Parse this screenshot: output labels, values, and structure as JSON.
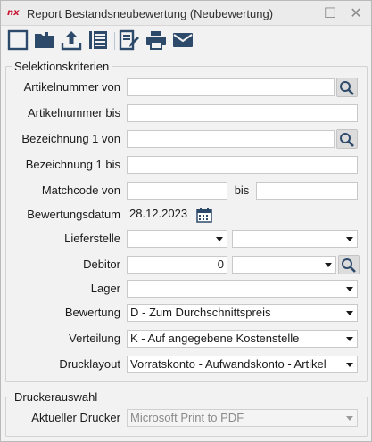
{
  "window": {
    "logo_text": "nx",
    "title": "Report Bestandsneubewertung (Neubewertung)",
    "maximize_glyph": "☐",
    "close_glyph": "✕"
  },
  "toolbar": {
    "buttons": [
      {
        "name": "new-icon"
      },
      {
        "name": "open-folder-icon"
      },
      {
        "name": "upload-icon"
      },
      {
        "name": "list-icon"
      },
      {
        "name": "edit-document-icon"
      },
      {
        "name": "print-icon"
      },
      {
        "name": "email-icon"
      }
    ]
  },
  "selection": {
    "legend": "Selektionskriterien",
    "artikel_von_label": "Artikelnummer von",
    "artikel_von_value": "",
    "artikel_bis_label": "Artikelnummer bis",
    "artikel_bis_value": "",
    "bez_von_label": "Bezeichnung 1 von",
    "bez_von_value": "",
    "bez_bis_label": "Bezeichnung 1 bis",
    "bez_bis_value": "",
    "matchcode_label": "Matchcode von",
    "matchcode_von_value": "",
    "matchcode_bis_label": "bis",
    "matchcode_bis_value": "",
    "datum_label": "Bewertungsdatum",
    "datum_value": "28.12.2023",
    "lieferstelle_label": "Lieferstelle",
    "lieferstelle_value1": "",
    "lieferstelle_value2": "",
    "debitor_label": "Debitor",
    "debitor_value": "0",
    "debitor_select_value": "",
    "lager_label": "Lager",
    "lager_value": "",
    "bewertung_label": "Bewertung",
    "bewertung_value": "D - Zum Durchschnittspreis",
    "verteilung_label": "Verteilung",
    "verteilung_value": "K - Auf angegebene Kostenstelle",
    "drucklayout_label": "Drucklayout",
    "drucklayout_value": "Vorratskonto - Aufwandskonto - Artikel"
  },
  "printer": {
    "legend": "Druckerauswahl",
    "label": "Aktueller Drucker",
    "value": "Microsoft Print to PDF"
  },
  "colors": {
    "toolbar_icon": "#2d4a6b",
    "brand_red": "#c8102e"
  }
}
